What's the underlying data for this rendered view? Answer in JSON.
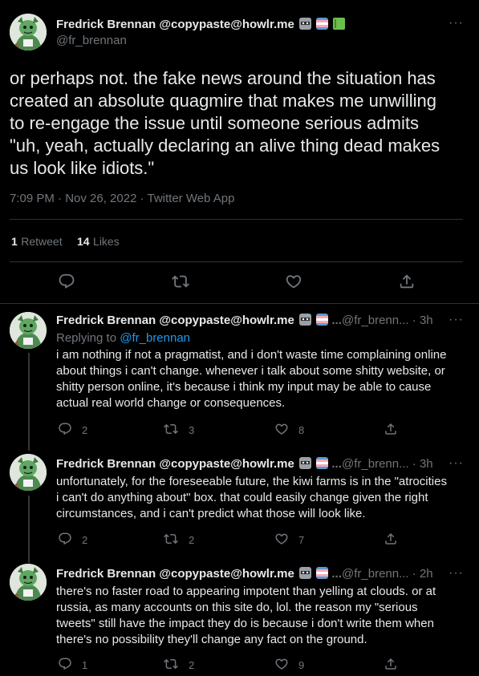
{
  "main_tweet": {
    "author_name": "Fredrick Brennan @copypaste@howlr.me",
    "author_handle": "@fr_brennan",
    "more_glyph": "···",
    "text_lines": [
      "or perhaps not. the fake news around the situation has",
      "created an absolute quagmire that makes me unwilling",
      "to re-engage the issue until someone serious admits",
      "\"uh, yeah, actually declaring an alive thing dead makes",
      "us look like idiots.\""
    ],
    "timestamp": "7:09 PM · Nov 26, 2022 · Twitter Web App",
    "retweets_count": "1",
    "retweets_label": "Retweet",
    "likes_count": "14",
    "likes_label": "Likes"
  },
  "replies": [
    {
      "author_name": "Fredrick Brennan @copypaste@howlr.me",
      "ellipsis": "...",
      "handle": "@fr_brenn...",
      "time": "· 3h",
      "more_glyph": "···",
      "replying_prefix": "Replying to",
      "replying_handle": "@fr_brennan",
      "lines": [
        "i am nothing if not a pragmatist, and i don't waste time complaining online",
        "about things i can't change. whenever i talk about some shitty website, or",
        "shitty person online, it's because i think my input may be able to cause",
        "actual real world change or consequences."
      ],
      "reply_count": "2",
      "retweet_count": "3",
      "like_count": "8"
    },
    {
      "author_name": "Fredrick Brennan @copypaste@howlr.me",
      "ellipsis": "...",
      "handle": "@fr_brenn...",
      "time": "· 3h",
      "more_glyph": "···",
      "lines": [
        "unfortunately, for the foreseeable future, the kiwi farms is in the \"atrocities",
        "i can't do anything about\" box. that could easily change given the right",
        "circumstances, and i can't predict what those will look like."
      ],
      "reply_count": "2",
      "retweet_count": "2",
      "like_count": "7"
    },
    {
      "author_name": "Fredrick Brennan @copypaste@howlr.me",
      "ellipsis": "...",
      "handle": "@fr_brenn...",
      "time": "· 2h",
      "more_glyph": "···",
      "lines": [
        "there's no faster road to appearing impotent than yelling at clouds. or at",
        "russia, as many accounts on this site do, lol. the reason my \"serious",
        "tweets\" still have the impact they do is because i don't write them when",
        "there's no possibility they'll change any fact on the ground."
      ],
      "reply_count": "1",
      "retweet_count": "2",
      "like_count": "9"
    }
  ],
  "colors": {
    "background": "#000000",
    "text": "#e7e9ea",
    "muted": "#71767b",
    "link": "#1d9bf0",
    "divider": "#2f3336"
  },
  "icons": [
    "reply-icon",
    "retweet-icon",
    "like-icon",
    "share-icon",
    "more-icon",
    "raccoon-emoji-icon",
    "trans-flag-emoji-icon",
    "book-emoji-icon"
  ]
}
